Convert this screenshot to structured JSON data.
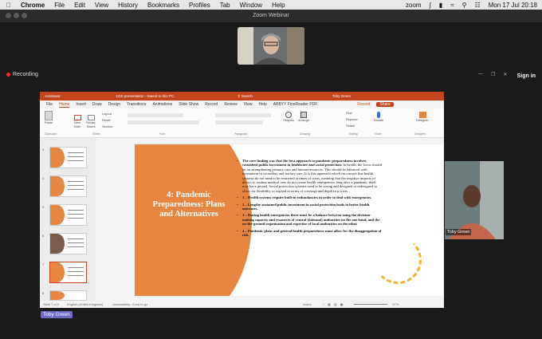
{
  "menubar": {
    "app": "Chrome",
    "items": [
      "File",
      "Edit",
      "View",
      "History",
      "Bookmarks",
      "Profiles",
      "Tab",
      "Window",
      "Help"
    ],
    "status_app": "zoom",
    "clock": "Mon 17 Jul  20:18"
  },
  "zoom": {
    "title": "Zoom Webinar",
    "recording": "Recording",
    "signin": "Sign in",
    "participant_label": "Toby Green",
    "speaker_label": "Toby Green"
  },
  "ppt": {
    "title": "1GS presentation - Saved to this PC",
    "user": "Toby Green",
    "tabs": [
      "File",
      "Home",
      "Insert",
      "Draw",
      "Design",
      "Transitions",
      "Animations",
      "Slide Show",
      "Record",
      "Review",
      "View",
      "Help",
      "ABBYY FineReader PDF"
    ],
    "active_tab": "Home",
    "record_btn": "Record",
    "share_btn": "Share",
    "ribbon": {
      "paste": "Paste",
      "new_slide": "New Slide",
      "reuse": "Reuse Slides",
      "layout": "Layout",
      "reset": "Reset",
      "section": "Section",
      "shapes": "Shapes",
      "arrange": "Arrange",
      "find": "Find",
      "replace": "Replace",
      "select": "Select",
      "dictate": "Dictate",
      "designer": "Designer",
      "groups": [
        "Clipboard",
        "Slides",
        "Font",
        "Paragraph",
        "Drawing",
        "Editing",
        "Voice",
        "Designer"
      ]
    },
    "thumbnails": [
      "3",
      "4",
      "5",
      "6",
      "7",
      "8"
    ],
    "status": {
      "slide": "Slide 7 of 9",
      "language": "English (United Kingdom)",
      "accessibility": "Accessibility: Good to go",
      "notes": "Notes",
      "zoom": "57%"
    },
    "slide": {
      "title": "4: Pandemic Preparedness: Plans and Alternatives",
      "bullets": [
        {
          "bold": "The core finding was that the best approach to pandemic preparedness involves consistent public investment in healthcare and social protection.",
          "text": " In health, the focus should be on strengthening primary care and human resources. This should be balanced with investment in secondary and tertiary care. It is this approach which can ensure that health systems do not need to be restricted at times of crisis, meaning that the negative impacts of delays to routine medical care do not create health emergencies long after a pandemic itself may have passed. Social protection systems need to be strong and designed or redesigned to allow for flexibility to expand in terms of coverage and depth in a crisis."
        },
        {
          "bold": "",
          "text": "1 – Health systems require built-in redundancies in order to deal with emergencies."
        },
        {
          "bold": "",
          "text": "2 – Lengthy sustained public investment in social protection leads to better health outcomes."
        },
        {
          "bold": "",
          "text": "3 – During health emergencies there must be a balance between using the decision-making capacity and resources of central (national) authorities on the one hand, and the on-the-ground organisation and expertise of local authorities on the other."
        },
        {
          "bold": "",
          "text": "4 – Pandemic plans and general health preparedness must allow for the disaggregation of risk."
        }
      ]
    }
  },
  "colors": {
    "accent": "#c4451d",
    "slide_orange": "#e6853f",
    "swirl": "#f2b32a",
    "zoom_label": "#6e6bc6"
  }
}
